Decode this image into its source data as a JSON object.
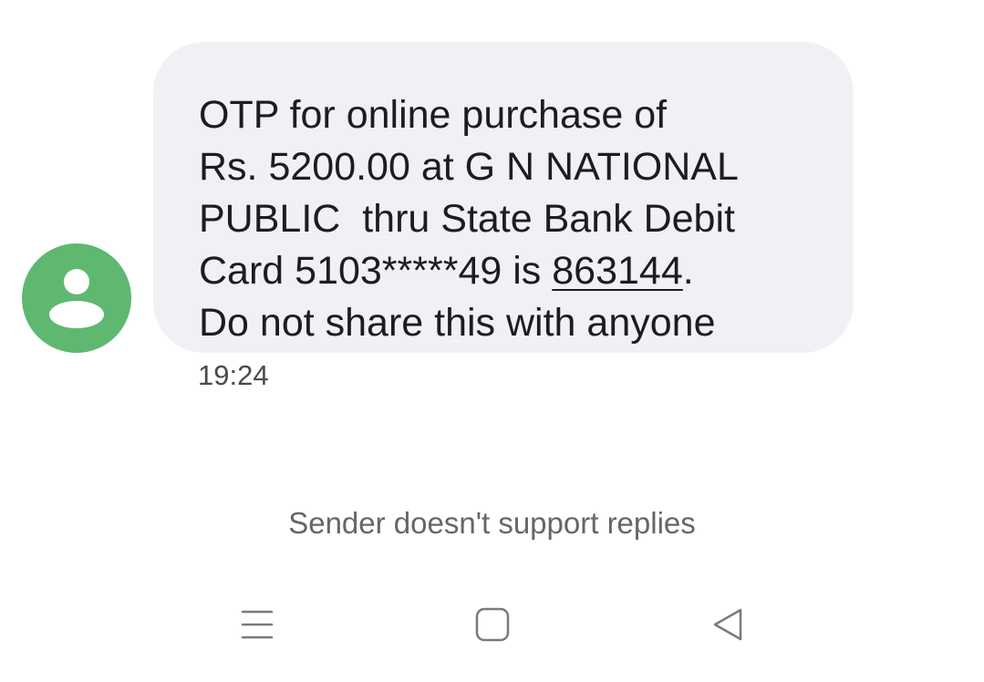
{
  "conversation": {
    "sender_avatar_icon": "person-icon",
    "avatar_color": "#5fb870",
    "bubble_color": "#f0f1f4",
    "message": {
      "line1": "OTP for online purchase of",
      "line2": "Rs. 5200.00 at G N NATIONAL",
      "line3": "PUBLIC  thru State Bank Debit",
      "line4_prefix": "Card 5103*****49 is ",
      "otp_code": "863144",
      "line4_suffix": ".",
      "line5": "Do not share this with anyone"
    },
    "timestamp": "19:24"
  },
  "footer": {
    "notice": "Sender doesn't support replies"
  },
  "navigation_bar": {
    "recents_icon": "menu-lines-icon",
    "home_icon": "square-home-icon",
    "back_icon": "triangle-back-icon"
  }
}
